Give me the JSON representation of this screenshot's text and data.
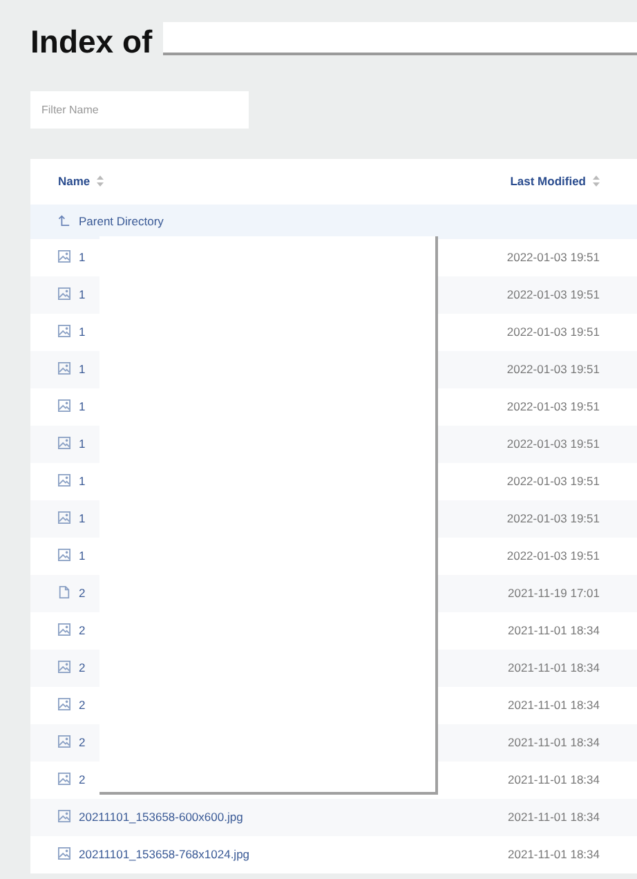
{
  "page": {
    "title": "Index of"
  },
  "filter": {
    "placeholder": "Filter Name"
  },
  "table": {
    "columns": [
      "Name",
      "Last Modified"
    ],
    "parent": {
      "label": "Parent Directory"
    },
    "rows": [
      {
        "kind": "image",
        "name": "1",
        "modified": "2022-01-03 19:51"
      },
      {
        "kind": "image",
        "name": "1",
        "modified": "2022-01-03 19:51"
      },
      {
        "kind": "image",
        "name": "1",
        "modified": "2022-01-03 19:51"
      },
      {
        "kind": "image",
        "name": "1",
        "modified": "2022-01-03 19:51"
      },
      {
        "kind": "image",
        "name": "1",
        "modified": "2022-01-03 19:51"
      },
      {
        "kind": "image",
        "name": "1",
        "modified": "2022-01-03 19:51"
      },
      {
        "kind": "image",
        "name": "1",
        "modified": "2022-01-03 19:51"
      },
      {
        "kind": "image",
        "name": "1",
        "modified": "2022-01-03 19:51"
      },
      {
        "kind": "image",
        "name": "1",
        "modified": "2022-01-03 19:51"
      },
      {
        "kind": "file",
        "name": "2",
        "modified": "2021-11-19 17:01"
      },
      {
        "kind": "image",
        "name": "2",
        "modified": "2021-11-01 18:34"
      },
      {
        "kind": "image",
        "name": "2",
        "modified": "2021-11-01 18:34"
      },
      {
        "kind": "image",
        "name": "2",
        "modified": "2021-11-01 18:34"
      },
      {
        "kind": "image",
        "name": "2",
        "modified": "2021-11-01 18:34"
      },
      {
        "kind": "image",
        "name": "2",
        "modified": "2021-11-01 18:34"
      },
      {
        "kind": "image",
        "name": "20211101_153658-600x600.jpg",
        "modified": "2021-11-01 18:34"
      },
      {
        "kind": "image",
        "name": "20211101_153658-768x1024.jpg",
        "modified": "2021-11-01 18:34"
      }
    ]
  }
}
